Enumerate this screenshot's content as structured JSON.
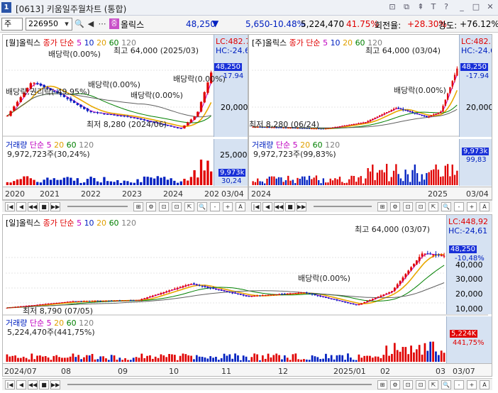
{
  "window": {
    "number": "1",
    "title": "[0613] 키움일주월차트 (통합)",
    "controls": [
      "⊡",
      "⧉",
      "⇞",
      "T",
      "?",
      "_",
      "□",
      "✕"
    ]
  },
  "toolbar": {
    "market": "주",
    "code": "226950",
    "name_badge": "중",
    "name": "올릭스",
    "price": "48,250",
    "change_arrow": "▼",
    "change": "5,650",
    "change_rate": "-10.48%",
    "volume": "5,224,470",
    "vol_rate": "41.75%",
    "turnover_label": "회전율:",
    "turnover": "+28.30%",
    "strength_label": "강도:",
    "strength": "+76.12%"
  },
  "panes": {
    "monthly": {
      "title": "[월]올릭스",
      "ma_label": "종가 단순",
      "ma": [
        "5",
        "10",
        "20",
        "60",
        "120"
      ],
      "high_note": "최고 64,000 (2025/03)",
      "low_note": "최저 8,280 (2024/06)",
      "lc": "LC:482.7",
      "hc": "HC:-24.6",
      "price_tag": "48,250",
      "price_rate": "-17.94",
      "axis_price": "20,000",
      "events": [
        "배당락(0.00%)",
        "배당락,권리락(-49.95%)",
        "배당락(0.00%)",
        "배당락(0.00%)",
        "배당락(0.00%)"
      ],
      "vol_title": "거래량",
      "vol_ma_label": "단순",
      "vol_ma": [
        "5",
        "20",
        "60",
        "120"
      ],
      "vol_value": "9,972,723주(30,24%)",
      "vol_axis": "25,000k",
      "vol_tag": "9,973k",
      "vol_rate": "30,24",
      "xlabels": [
        "2020",
        "2021",
        "2022",
        "2023",
        "2024",
        "202"
      ],
      "xend": "03/04"
    },
    "weekly": {
      "title": "[주]올릭스",
      "ma_label": "종가 단순",
      "ma": [
        "5",
        "10",
        "20",
        "60",
        "120"
      ],
      "high_note": "최고 64,000 (03/04)",
      "low_note": "최저 8,280 (06/24)",
      "lc": "LC:482.7",
      "hc": "HC:-24.6",
      "price_tag": "48,250",
      "price_rate": "-17.94",
      "axis_price": "20,000",
      "events": [
        "배당락(0.00%)"
      ],
      "vol_title": "거래량",
      "vol_ma_label": "단순",
      "vol_ma": [
        "5",
        "20",
        "60",
        "120"
      ],
      "vol_value": "9,972,723주(99,83%)",
      "vol_tag": "9,973k",
      "vol_rate": "99,83",
      "xlabels": [
        "2024",
        "2025"
      ],
      "xend": "03/04"
    },
    "daily": {
      "title": "[일]올릭스",
      "ma_label": "종가 단순",
      "ma": [
        "5",
        "10",
        "20",
        "60",
        "120"
      ],
      "high_note": "최고 64,000 (03/07)",
      "low_note": "최저 8,790 (07/05)",
      "lc": "LC:448,92",
      "hc": "HC:-24,61",
      "price_tag": "48,250",
      "price_rate": "-10,48%",
      "axis": [
        "40,000",
        "30,000",
        "20,000",
        "10,000"
      ],
      "events": [
        "배당락(0.00%)"
      ],
      "vol_title": "거래량",
      "vol_ma_label": "단순",
      "vol_ma": [
        "5",
        "20",
        "60",
        "120"
      ],
      "vol_value": "5,224,470주(441,75%)",
      "vol_tag": "5,224K",
      "vol_rate": "441,75%",
      "xlabels": [
        "2024/07",
        "08",
        "09",
        "10",
        "11",
        "12",
        "2025/01",
        "02",
        "03"
      ],
      "xend": "03/07"
    }
  },
  "nav_icons": [
    "|◀",
    "◀",
    "◀◀",
    "■",
    "▶▶",
    "⊞",
    "⚙",
    "⊡",
    "⊡",
    "⇱",
    "🔍",
    "-",
    "+",
    "A"
  ],
  "colors": {
    "up": "#e00000",
    "down": "#0020c0",
    "ma5": "#c000c0",
    "ma20": "#e8a800",
    "ma60": "#008000",
    "ma120": "#606060",
    "axis_bg": "#d6e2f2"
  }
}
